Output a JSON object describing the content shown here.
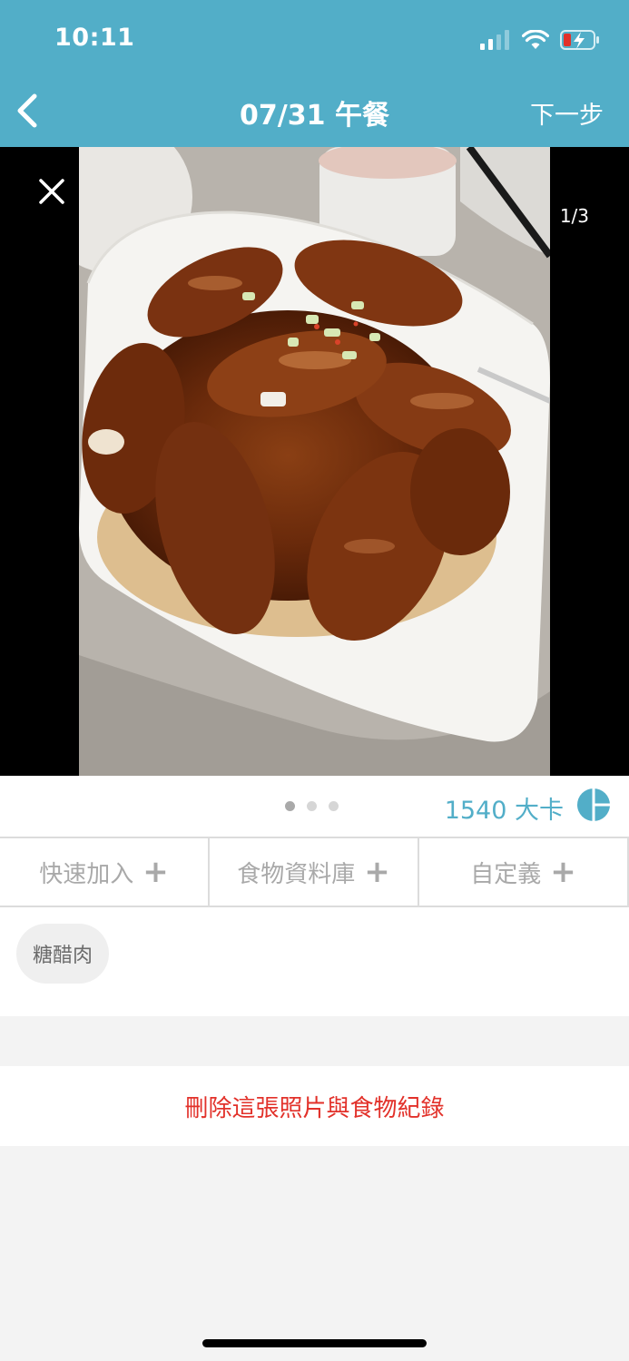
{
  "status": {
    "time": "10:11",
    "icons": [
      "signal-icon",
      "wifi-icon",
      "battery-icon"
    ]
  },
  "nav": {
    "title": "07/31 午餐",
    "next_label": "下一步"
  },
  "photo": {
    "counter": "1/3",
    "page_indicator": {
      "total": 3,
      "active": 1
    }
  },
  "meal": {
    "calories": "1540 大卡"
  },
  "tabs": [
    {
      "label": "快速加入"
    },
    {
      "label": "食物資料庫"
    },
    {
      "label": "自定義"
    }
  ],
  "foods": [
    {
      "name": "糖醋肉"
    }
  ],
  "actions": {
    "delete_label": "刪除這張照片與食物紀錄"
  },
  "colors": {
    "accent": "#52aec8",
    "danger": "#e2312a",
    "muted": "#a9a9a9",
    "page_bg": "#f3f3f3"
  }
}
